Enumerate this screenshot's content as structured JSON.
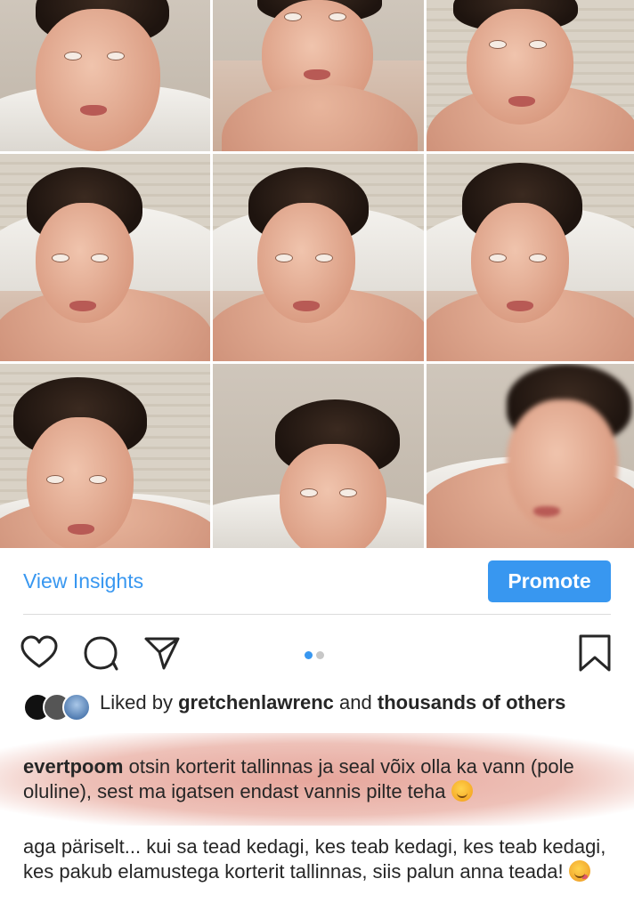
{
  "post": {
    "insights_label": "View Insights",
    "promote_label": "Promote"
  },
  "icons": {
    "like": "heart-icon",
    "comment": "comment-bubble-icon",
    "share": "paper-plane-icon",
    "save": "bookmark-icon"
  },
  "carousel": {
    "total": 2,
    "active": 1
  },
  "likes": {
    "prefix": "Liked by",
    "user": "gretchenlawrenc",
    "and": "and",
    "others": "thousands of others"
  },
  "caption": {
    "username": "evertpoom",
    "text": "otsin korterit tallinnas ja seal võix olla ka vann (pole oluline), sest ma igatsen endast vannis pilte teha"
  },
  "comment": {
    "text": "aga päriselt... kui sa tead kedagi, kes teab kedagi, kes teab kedagi, kes pakub elamustega korterit tallinnas, siis palun anna teada!"
  },
  "colors": {
    "accent": "#3897f0",
    "highlight": "#e2968a"
  }
}
